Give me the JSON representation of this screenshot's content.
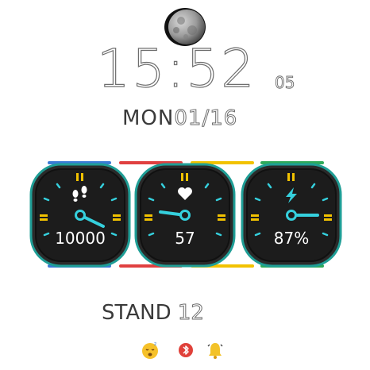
{
  "time": {
    "hm": "15:52",
    "seconds": "05"
  },
  "date": {
    "day_of_week": "MON",
    "date": "01/16"
  },
  "gauges": [
    {
      "name": "steps",
      "icon": "footprints-icon",
      "value": "10000",
      "accent": "#3a7bd5"
    },
    {
      "name": "heart-rate",
      "icon": "heart-icon",
      "value": "57",
      "accent": "#e04040"
    },
    {
      "name": "battery",
      "icon": "lightning-icon",
      "value": "87%",
      "accent": "#f2c200"
    }
  ],
  "segments": [
    "#3a7bd5",
    "#e04040",
    "#f2c200",
    "#2eaa5a"
  ],
  "stand": {
    "label": "STAND",
    "value": "12"
  },
  "status_icons": [
    "sleep-emoji-icon",
    "bluetooth-icon",
    "bell-icon"
  ],
  "colors": {
    "ring": "#1f9e96",
    "dial_face": "#262626",
    "hand": "#35d0dd",
    "marker": "#f2c200",
    "text": "#3a3a3a"
  }
}
